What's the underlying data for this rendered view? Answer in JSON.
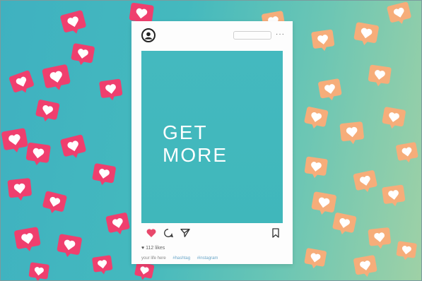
{
  "post": {
    "headline": "GET\nMORE",
    "likes_text": "112 likes",
    "caption_user": "your life here",
    "hashtags": [
      "#hashtag",
      "#instagram"
    ]
  },
  "icons": {
    "profile": "user-avatar-icon",
    "options": "more-options-icon",
    "like": "heart-icon",
    "comment": "comment-icon",
    "share": "share-icon",
    "bookmark": "bookmark-icon",
    "badges": "like-notification-heart-icon"
  },
  "colors": {
    "background_left": "#3fb1c0",
    "background_right": "#9fd1a6",
    "pink_badge": "#ef3f6e",
    "peach_badge": "#f6ad7a",
    "photo": "#44b9bf",
    "heart": "#e8486b",
    "frame": "#fdfdfd"
  }
}
